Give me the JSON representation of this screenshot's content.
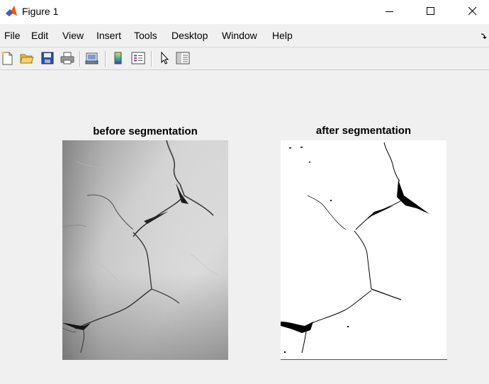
{
  "window": {
    "title": "Figure 1",
    "controls": {
      "minimize": "minimize",
      "maximize": "maximize",
      "close": "close"
    }
  },
  "menu": {
    "items": [
      "File",
      "Edit",
      "View",
      "Insert",
      "Tools",
      "Desktop",
      "Window",
      "Help"
    ]
  },
  "toolbar": {
    "icons": [
      "new-figure-icon",
      "open-file-icon",
      "save-icon",
      "print-icon",
      "link-plot-icon",
      "insert-colorbar-icon",
      "insert-legend-icon",
      "edit-plot-arrow-icon",
      "property-inspector-icon"
    ]
  },
  "figure": {
    "left_axes": {
      "title": "before segmentation"
    },
    "right_axes": {
      "title": "after segmentation"
    }
  }
}
